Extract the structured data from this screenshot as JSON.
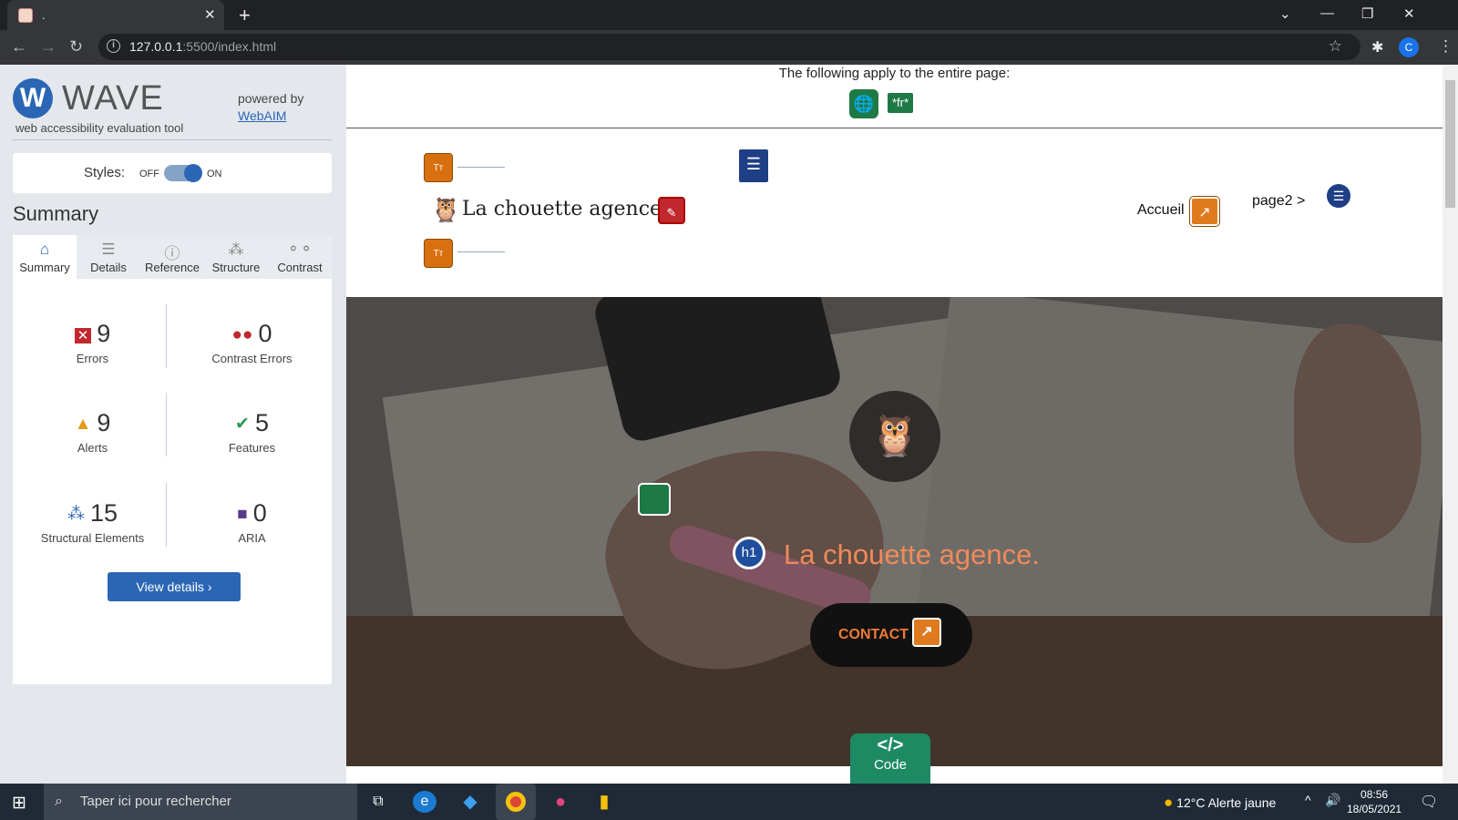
{
  "browser": {
    "tab_title": ".",
    "url_host": "127.0.0.1",
    "url_path": ":5500/index.html",
    "avatar_letter": "C"
  },
  "wave": {
    "logo_text": "WAVE",
    "tagline": "web accessibility evaluation tool",
    "powered_by": "powered by",
    "webaim_link": "WebAIM",
    "styles_label": "Styles:",
    "styles_off": "OFF",
    "styles_on": "ON",
    "summary_title": "Summary",
    "tabs": [
      {
        "label": "Summary",
        "icon": "home-icon"
      },
      {
        "label": "Details",
        "icon": "list-icon"
      },
      {
        "label": "Reference",
        "icon": "info-icon"
      },
      {
        "label": "Structure",
        "icon": "hierarchy-icon"
      },
      {
        "label": "Contrast",
        "icon": "contrast-icon"
      }
    ],
    "stats": [
      {
        "count": "9",
        "label": "Errors",
        "icon": "error-icon",
        "color": "#c0282d"
      },
      {
        "count": "0",
        "label": "Contrast Errors",
        "icon": "contrast-error-icon",
        "color": "#c0282d"
      },
      {
        "count": "9",
        "label": "Alerts",
        "icon": "alert-icon",
        "color": "#e39a1d"
      },
      {
        "count": "5",
        "label": "Features",
        "icon": "feature-icon",
        "color": "#2c9a4d"
      },
      {
        "count": "15",
        "label": "Structural Elements",
        "icon": "structure-icon",
        "color": "#2b66b4"
      },
      {
        "count": "0",
        "label": "ARIA",
        "icon": "aria-icon",
        "color": "#5b3a8c"
      }
    ],
    "view_details": "View details ›"
  },
  "page": {
    "applies_text": "The following apply to the entire page:",
    "lang_badge": "*fr*",
    "brand": "La chouette agence",
    "nav_home": "Accueil",
    "nav_page2": "page2 >",
    "hero_title": "La chouette agence.",
    "h1_badge": "h1",
    "contact": "CONTACT",
    "code_label": "Code",
    "code_symbol": "</>"
  },
  "wave_icon_text": {
    "text_small": "Tт"
  },
  "taskbar": {
    "search_placeholder": "Taper ici pour rechercher",
    "temperature": "12°C",
    "weather_text": "Alerte jaune",
    "time": "08:56",
    "date": "18/05/2021"
  }
}
